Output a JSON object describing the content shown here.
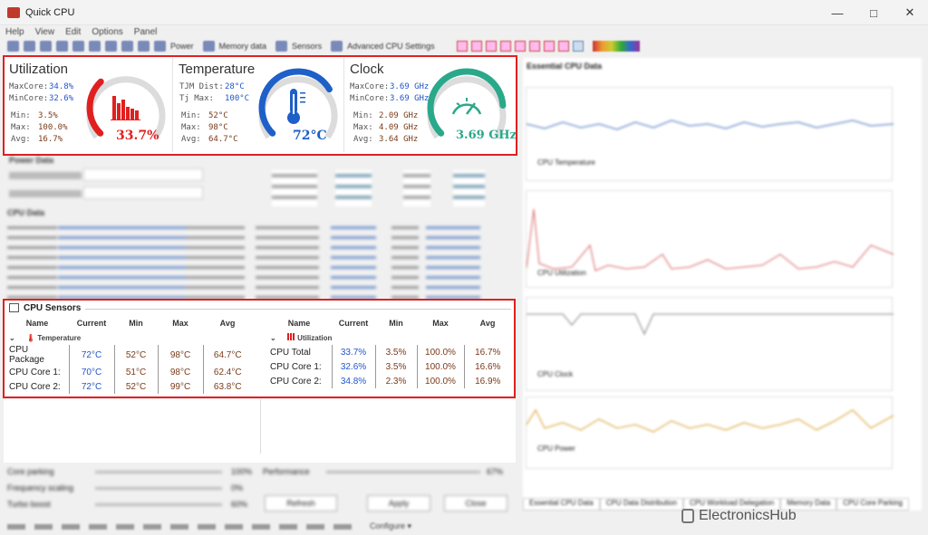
{
  "app": {
    "title": "Quick CPU"
  },
  "menu": [
    "Help",
    "View",
    "Edit",
    "Options",
    "Panel"
  ],
  "toolbar": {
    "power": "Power",
    "memory": "Memory data",
    "sensors": "Sensors",
    "advanced": "Advanced CPU Settings"
  },
  "gauges": {
    "utilization": {
      "title": "Utilization",
      "maxcore_k": "MaxCore:",
      "maxcore_v": "34.8%",
      "mincore_k": "MinCore:",
      "mincore_v": "32.6%",
      "min_k": "Min:",
      "min_v": "3.5%",
      "max_k": "Max:",
      "max_v": "100.0%",
      "avg_k": "Avg:",
      "avg_v": "16.7%",
      "value": "33.7%",
      "fraction": 0.337,
      "color": "#e02020"
    },
    "temperature": {
      "title": "Temperature",
      "tjm_k": "TJM Dist:",
      "tjm_v": "28°C",
      "tj_k": "Tj Max:",
      "tj_v": "100°C",
      "min_k": "Min:",
      "min_v": "52°C",
      "max_k": "Max:",
      "max_v": "98°C",
      "avg_k": "Avg:",
      "avg_v": "64.7°C",
      "value": "72°C",
      "fraction": 0.72,
      "color": "#1e5fc8"
    },
    "clock": {
      "title": "Clock",
      "maxcore_k": "MaxCore:",
      "maxcore_v": "3.69 GHz",
      "mincore_k": "MinCore:",
      "mincore_v": "3.69 GHz",
      "min_k": "Min:",
      "min_v": "2.09 GHz",
      "max_k": "Max:",
      "max_v": "4.09 GHz",
      "avg_k": "Avg:",
      "avg_v": "3.64 GHz",
      "value": "3.69 GHz",
      "fraction": 0.82,
      "color": "#2aa88a"
    }
  },
  "sections": {
    "power": "Power Data",
    "cpu": "CPU Data"
  },
  "sensors": {
    "title": "CPU Sensors",
    "headers": [
      "Name",
      "Current",
      "Min",
      "Max",
      "Avg"
    ],
    "temp_group": "Temperature",
    "temp_rows": [
      {
        "name": "CPU Package",
        "cur": "72°C",
        "min": "52°C",
        "max": "98°C",
        "avg": "64.7°C"
      },
      {
        "name": "CPU Core 1:",
        "cur": "70°C",
        "min": "51°C",
        "max": "98°C",
        "avg": "62.4°C"
      },
      {
        "name": "CPU Core 2:",
        "cur": "72°C",
        "min": "52°C",
        "max": "99°C",
        "avg": "63.8°C"
      }
    ],
    "util_group": "Utilization",
    "util_rows": [
      {
        "name": "CPU Total",
        "cur": "33.7%",
        "min": "3.5%",
        "max": "100.0%",
        "avg": "16.7%"
      },
      {
        "name": "CPU Core 1:",
        "cur": "32.6%",
        "min": "3.5%",
        "max": "100.0%",
        "avg": "16.6%"
      },
      {
        "name": "CPU Core 2:",
        "cur": "34.8%",
        "min": "2.3%",
        "max": "100.0%",
        "avg": "16.9%"
      }
    ]
  },
  "bottom": {
    "core_parking": "Core parking",
    "freq_scaling": "Frequency scaling",
    "turbo": "Turbo boost",
    "performance": "Performance",
    "refresh": "Refresh",
    "apply": "Apply",
    "close": "Close",
    "cp_val": "100%",
    "fs_val": "0%",
    "tb_val": "60%",
    "perf_val": "67%"
  },
  "right": {
    "header": "Essential CPU Data",
    "g1": "CPU Temperature",
    "g2": "CPU Utilization",
    "g3": "CPU Clock",
    "g4": "CPU Power",
    "tabs": [
      "Essential CPU Data",
      "CPU Data Distribution",
      "CPU Workload Delegation",
      "Memory Data",
      "CPU Core Parking"
    ]
  },
  "watermark": {
    "text": "ElectronicsHub"
  },
  "status": {
    "configure": "Configure ▾"
  }
}
